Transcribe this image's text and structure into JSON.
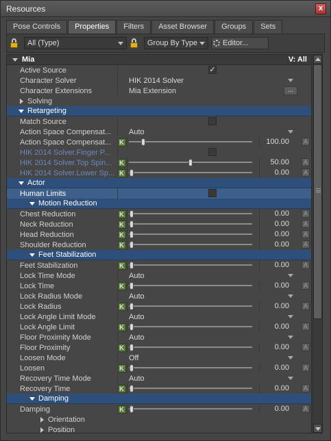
{
  "window": {
    "title": "Resources"
  },
  "tabs": [
    {
      "label": "Pose Controls",
      "active": false
    },
    {
      "label": "Properties",
      "active": true
    },
    {
      "label": "Filters",
      "active": false
    },
    {
      "label": "Asset Browser",
      "active": false
    },
    {
      "label": "Groups",
      "active": false
    },
    {
      "label": "Sets",
      "active": false
    }
  ],
  "toolbar": {
    "type_filter": "All (Type)",
    "group_by": "Group By Type",
    "editor_label": "Editor..."
  },
  "header": {
    "name": "Mia",
    "view": "V: All"
  },
  "rows": {
    "active_source": {
      "label": "Active Source",
      "checked": true
    },
    "character_solver": {
      "label": "Character Solver",
      "value": "HIK 2014 Solver"
    },
    "character_extensions": {
      "label": "Character Extensions",
      "value": "Mia Extension",
      "button": "..."
    },
    "solving": {
      "label": "Solving"
    },
    "retargeting": {
      "label": "Retargeting"
    },
    "match_source": {
      "label": "Match Source"
    },
    "action_space_1": {
      "label": "Action Space Compensat...",
      "value": "Auto"
    },
    "action_space_2": {
      "label": "Action Space Compensat...",
      "value": "100.00",
      "fraction": 0.1
    },
    "finger_p": {
      "label": "HIK 2014 Solver.Finger P..."
    },
    "top_spine": {
      "label": "HIK 2014 Solver.Top Spin...",
      "value": "50.00",
      "fraction": 0.5
    },
    "lower_sp": {
      "label": "HIK 2014 Solver.Lower Sp...",
      "value": "0.00",
      "fraction": 0.0
    },
    "actor": {
      "label": "Actor"
    },
    "human_limits": {
      "label": "Human Limits"
    },
    "motion_reduction": {
      "label": "Motion Reduction"
    },
    "chest_reduction": {
      "label": "Chest Reduction",
      "value": "0.00",
      "fraction": 0.0
    },
    "neck_reduction": {
      "label": "Neck Reduction",
      "value": "0.00",
      "fraction": 0.0
    },
    "head_reduction": {
      "label": "Head Reduction",
      "value": "0.00",
      "fraction": 0.0
    },
    "shoulder_reduction": {
      "label": "Shoulder Reduction",
      "value": "0.00",
      "fraction": 0.0
    },
    "feet_stabilization_section": {
      "label": "Feet Stabilization"
    },
    "feet_stabilization": {
      "label": "Feet Stabilization",
      "value": "0.00",
      "fraction": 0.0
    },
    "lock_time_mode": {
      "label": "Lock Time Mode",
      "value": "Auto"
    },
    "lock_time": {
      "label": "Lock Time",
      "value": "0.00",
      "fraction": 0.0
    },
    "lock_radius_mode": {
      "label": "Lock Radius Mode",
      "value": "Auto"
    },
    "lock_radius": {
      "label": "Lock Radius",
      "value": "0.00",
      "fraction": 0.0
    },
    "lock_angle_limit_mode": {
      "label": "Lock Angle Limit Mode",
      "value": "Auto"
    },
    "lock_angle_limit": {
      "label": "Lock Angle Limit",
      "value": "0.00",
      "fraction": 0.0
    },
    "floor_proximity_mode": {
      "label": "Floor Proximity Mode",
      "value": "Auto"
    },
    "floor_proximity": {
      "label": "Floor Proximity",
      "value": "0.00",
      "fraction": 0.0
    },
    "loosen_mode": {
      "label": "Loosen Mode",
      "value": "Off"
    },
    "loosen": {
      "label": "Loosen",
      "value": "0.00",
      "fraction": 0.0
    },
    "recovery_time_mode": {
      "label": "Recovery Time Mode",
      "value": "Auto"
    },
    "recovery_time": {
      "label": "Recovery Time",
      "value": "0.00",
      "fraction": 0.0
    },
    "damping_section": {
      "label": "Damping"
    },
    "damping": {
      "label": "Damping",
      "value": "0.00",
      "fraction": 0.0
    },
    "orientation": {
      "label": "Orientation"
    },
    "position": {
      "label": "Position"
    }
  },
  "buttons": {
    "key": "K",
    "anim": "A",
    "close": "x"
  },
  "icons": {
    "lock": "lock-icon",
    "close": "close-icon",
    "gear": "gear-icon",
    "checkmark": "✓"
  },
  "colors": {
    "section_bg": "#2d4f79",
    "key_button": "#5b7a3e",
    "disabled_label": "#6d88c0"
  }
}
